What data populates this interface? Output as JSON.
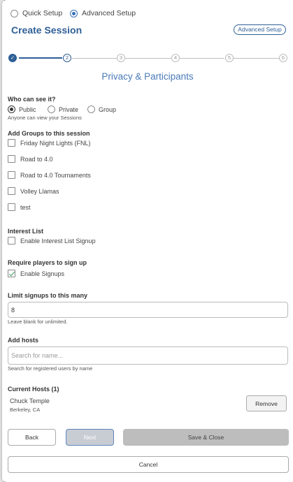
{
  "setup_mode": {
    "options": [
      {
        "label": "Quick Setup",
        "selected": false
      },
      {
        "label": "Advanced Setup",
        "selected": true
      }
    ]
  },
  "header": {
    "title": "Create Session",
    "advanced_button": "Advanced Setup"
  },
  "stepper": {
    "steps": [
      "✓",
      "2",
      "3",
      "4",
      "5",
      "6"
    ],
    "current": 2
  },
  "section_title": "Privacy & Participants",
  "visibility": {
    "label": "Who can see it?",
    "options": [
      {
        "label": "Public",
        "selected": true
      },
      {
        "label": "Private",
        "selected": false
      },
      {
        "label": "Group",
        "selected": false
      }
    ],
    "hint": "Anyone can view your Sessions"
  },
  "groups": {
    "label": "Add Groups to this session",
    "items": [
      {
        "label": "Friday Night Lights (FNL)",
        "checked": false
      },
      {
        "label": "Road to 4.0",
        "checked": false
      },
      {
        "label": "Road to 4.0 Tournaments",
        "checked": false
      },
      {
        "label": "Volley Llamas",
        "checked": false
      },
      {
        "label": "test",
        "checked": false
      }
    ]
  },
  "interest_list": {
    "label": "Interest List",
    "checkbox_label": "Enable Interest List Signup",
    "checked": false
  },
  "signup": {
    "label": "Require players to sign up",
    "checkbox_label": "Enable Signups",
    "checked": true
  },
  "limit": {
    "label": "Limit signups to this many",
    "value": "8",
    "hint": "Leave blank for unlimited."
  },
  "hosts": {
    "label": "Add hosts",
    "placeholder": "Search for name...",
    "hint": "Search for registered users by name"
  },
  "current_hosts": {
    "label": "Current Hosts (1)",
    "items": [
      {
        "name": "Chuck Temple",
        "location": "Berkeley, CA",
        "action": "Remove"
      }
    ]
  },
  "footer": {
    "back": "Back",
    "next": "Next",
    "save": "Save & Close",
    "cancel": "Cancel"
  }
}
